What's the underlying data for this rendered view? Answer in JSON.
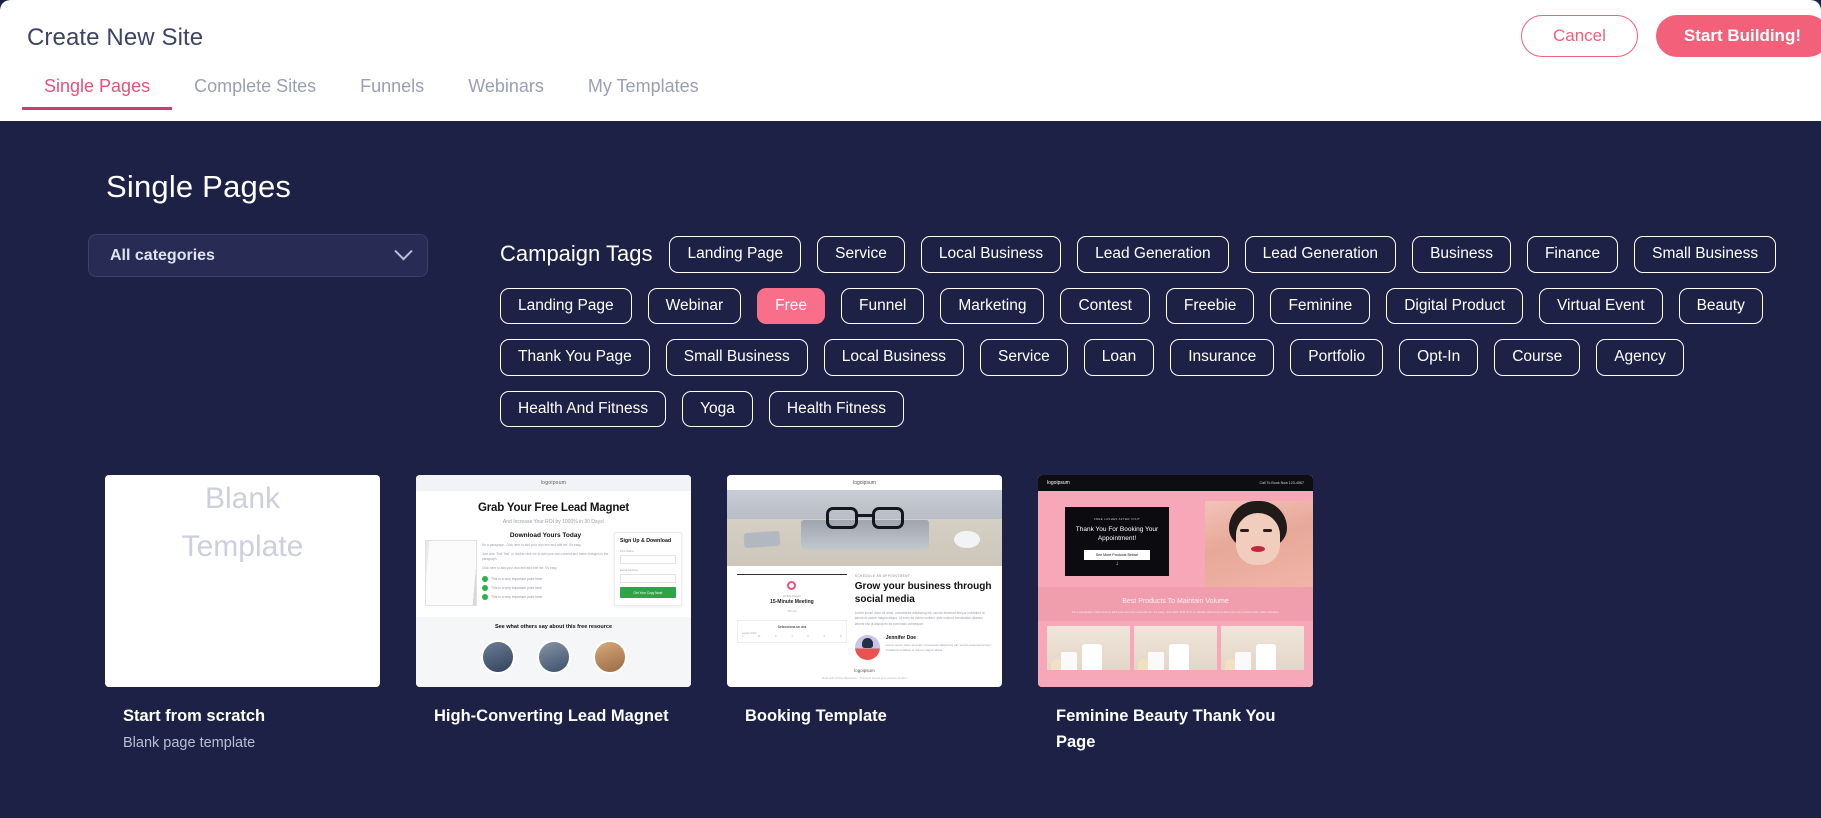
{
  "header": {
    "title": "Create New Site",
    "cancel_label": "Cancel",
    "start_label": "Start Building!"
  },
  "tabs": [
    {
      "label": "Single Pages",
      "active": true
    },
    {
      "label": "Complete Sites",
      "active": false
    },
    {
      "label": "Funnels",
      "active": false
    },
    {
      "label": "Webinars",
      "active": false
    },
    {
      "label": "My Templates",
      "active": false
    }
  ],
  "section": {
    "title": "Single Pages"
  },
  "filters": {
    "category_select": {
      "value": "All categories",
      "icon": "chevron-down-icon"
    },
    "tags_label": "Campaign Tags",
    "tags": [
      {
        "label": "Landing Page",
        "selected": false
      },
      {
        "label": "Service",
        "selected": false
      },
      {
        "label": "Local Business",
        "selected": false
      },
      {
        "label": "Lead Generation",
        "selected": false
      },
      {
        "label": "Lead Generation",
        "selected": false
      },
      {
        "label": "Business",
        "selected": false
      },
      {
        "label": "Finance",
        "selected": false
      },
      {
        "label": "Small Business",
        "selected": false
      },
      {
        "label": "Landing Page",
        "selected": false
      },
      {
        "label": "Webinar",
        "selected": false
      },
      {
        "label": "Free",
        "selected": true
      },
      {
        "label": "Funnel",
        "selected": false
      },
      {
        "label": "Marketing",
        "selected": false
      },
      {
        "label": "Contest",
        "selected": false
      },
      {
        "label": "Freebie",
        "selected": false
      },
      {
        "label": "Feminine",
        "selected": false
      },
      {
        "label": "Digital Product",
        "selected": false
      },
      {
        "label": "Virtual Event",
        "selected": false
      },
      {
        "label": "Beauty",
        "selected": false
      },
      {
        "label": "Thank You Page",
        "selected": false
      },
      {
        "label": "Small Business",
        "selected": false
      },
      {
        "label": "Local Business",
        "selected": false
      },
      {
        "label": "Service",
        "selected": false
      },
      {
        "label": "Loan",
        "selected": false
      },
      {
        "label": "Insurance",
        "selected": false
      },
      {
        "label": "Portfolio",
        "selected": false
      },
      {
        "label": "Opt-In",
        "selected": false
      },
      {
        "label": "Course",
        "selected": false
      },
      {
        "label": "Agency",
        "selected": false
      },
      {
        "label": "Health And Fitness",
        "selected": false
      },
      {
        "label": "Yoga",
        "selected": false
      },
      {
        "label": "Health Fitness",
        "selected": false
      }
    ]
  },
  "cards": [
    {
      "title": "Start from scratch",
      "subtitle": "Blank page template",
      "thumb_kind": "blank",
      "thumb_text_line1": "Blank",
      "thumb_text_line2": "Template"
    },
    {
      "title": "High-Converting Lead Magnet",
      "subtitle": "",
      "thumb_kind": "lead-magnet",
      "thumb_logo": "logoipsum",
      "thumb_heading": "Grab Your Free Lead Magnet",
      "thumb_subheading": "And Increase Your ROI by 1000% in 30 Days!",
      "thumb_section_heading": "Download Yours Today",
      "thumb_paragraphs": [
        "I'm a paragraph. Click here to add your own text and edit me. It's easy.",
        "Just click \"Edit Text\" or double click me to add your own content and make changes to the paragraph.",
        "Click here to add your own text and edit me. It's easy."
      ],
      "thumb_bullets": [
        "This is a very important point here",
        "This is a very important point here",
        "This is a very important point here"
      ],
      "thumb_form_title": "Sign Up & Download",
      "thumb_form_fields": [
        "First Name",
        "Email Address"
      ],
      "thumb_form_button": "Get Your Copy Now!",
      "thumb_footer_heading": "See what others say about this free resource"
    },
    {
      "title": "Booking Template",
      "subtitle": "",
      "thumb_kind": "booking",
      "thumb_logo": "logoipsum",
      "thumb_kicker": "SCHEDULE AN APPOINTMENT",
      "thumb_heading": "Grow your business through social media",
      "thumb_paragraph": "Lorem ipsum dolor sit amet, consectetur adipiscing elit, sed do eiusmod tempor incididunt ut labore et dolore magna aliqua. Ut enim ad minim veniam, quis nostrud exercitation ullamco laboris nisi ut aliquip ex ea commodo consequat.",
      "thumb_meeting_label": "Online Pages",
      "thumb_meeting_title": "15-Minute Meeting",
      "thumb_meeting_duration": "15 min",
      "thumb_calendar_label": "Selecciona un día",
      "thumb_calendar_month": "agosto 2020",
      "thumb_author_name": "Jennifer Doe",
      "thumb_author_bio": "Lorem ipsum dolor sit amet, consectetur adipiscing elit, sed do eiusmod tempor incididunt ut labore et dolore magna aliqua.",
      "thumb_footer_text": "Built with Online Business - The best funnel and website builder"
    },
    {
      "title": "Feminine Beauty Thank You Page",
      "subtitle": "",
      "thumb_kind": "feminine",
      "thumb_logo": "logoipsum",
      "thumb_phone": "Call To Book Now 123-4567",
      "thumb_kicker": "FREE LASHES AFTER VISIT",
      "thumb_heading": "Thank You For Booking Your Appointment!",
      "thumb_button": "See More Products Below!",
      "thumb_section_heading": "Best Products To Maintain Volume",
      "thumb_section_paragraph": "I'm a paragraph. Click here to add your own text and edit me. It's easy. Just click \"Edit Text\" or double click here to add your own content and make changes."
    }
  ],
  "colors": {
    "page_background": "#1d2145",
    "header_background": "#ffffff",
    "accent_pink": "#f2607a",
    "tab_active": "#e8517a",
    "tag_selected": "#f96e88"
  }
}
